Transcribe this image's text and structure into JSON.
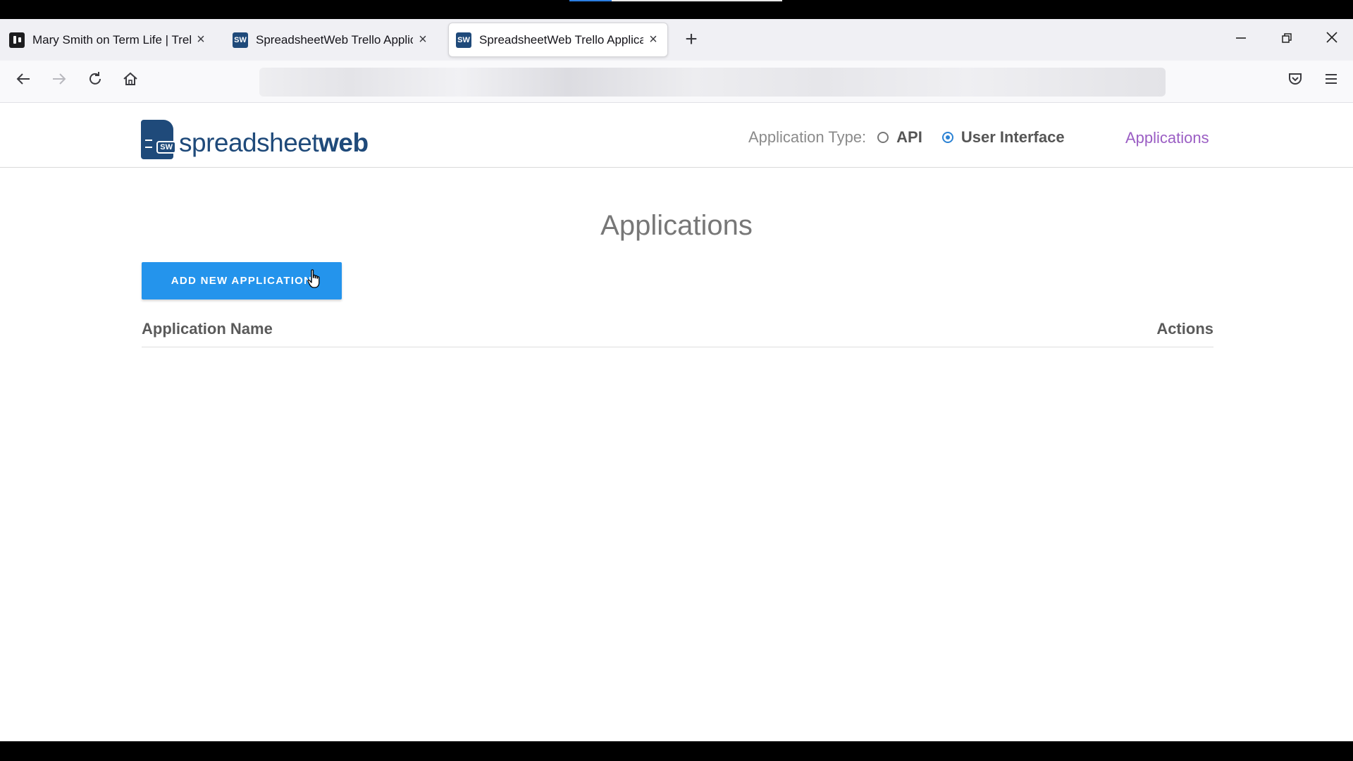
{
  "browser": {
    "tabs": [
      {
        "title": "Mary Smith on Term Life | Trello",
        "favicon": "trello-icon",
        "active": false
      },
      {
        "title": "SpreadsheetWeb Trello Applicat",
        "favicon": "sw-icon",
        "active": false
      },
      {
        "title": "SpreadsheetWeb Trello Applicat",
        "favicon": "sw-icon",
        "active": true
      }
    ],
    "favicon_text": "SW",
    "url": ""
  },
  "app": {
    "logo": {
      "light": "spreadsheet",
      "bold": "web",
      "badge": "SW"
    },
    "application_type_label": "Application Type:",
    "application_type_options": [
      {
        "label": "API",
        "checked": false
      },
      {
        "label": "User Interface",
        "checked": true
      }
    ],
    "nav_link": "Applications"
  },
  "main": {
    "title": "Applications",
    "add_button": "ADD NEW APPLICATION",
    "table": {
      "columns": [
        "Application Name",
        "Actions"
      ],
      "rows": []
    }
  },
  "colors": {
    "brand": "#1f4a7a",
    "primary_button": "#2494ec",
    "link": "#9b5ec4",
    "radio_selected": "#2b82d4"
  }
}
